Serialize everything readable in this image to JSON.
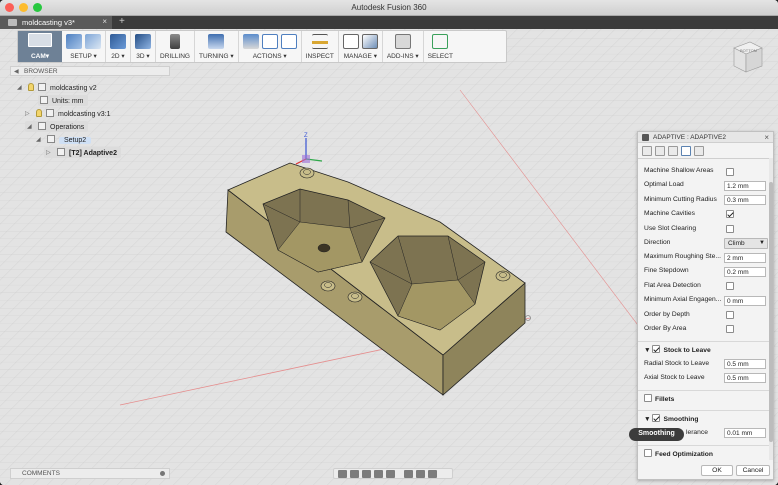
{
  "window": {
    "title": "Autodesk Fusion 360",
    "traffic_lights": [
      "#fc5f57",
      "#fdbc2e",
      "#28c840"
    ]
  },
  "tabs": {
    "document": "moldcasting v3*",
    "close": "×",
    "new_tab": "+"
  },
  "toolbar": {
    "workspace": "CAM▾",
    "groups": [
      {
        "label": "SETUP ▾",
        "icons": [
          "setup-icon",
          "setup-stock-icon"
        ]
      },
      {
        "label": "2D ▾",
        "icons": [
          "2d-pocket-icon"
        ]
      },
      {
        "label": "3D ▾",
        "icons": [
          "3d-adaptive-icon"
        ]
      },
      {
        "label": "DRILLING",
        "icons": [
          "drill-icon"
        ]
      },
      {
        "label": "TURNING ▾",
        "icons": [
          "turning-icon"
        ]
      },
      {
        "label": "ACTIONS ▾",
        "icons": [
          "simulate-icon",
          "post-process-icon",
          "setup-sheet-icon"
        ]
      },
      {
        "label": "INSPECT",
        "icons": [
          "measure-icon"
        ]
      },
      {
        "label": "MANAGE ▾",
        "icons": [
          "tool-library-icon",
          "template-icon"
        ]
      },
      {
        "label": "ADD-INS ▾",
        "icons": [
          "scripts-icon"
        ]
      },
      {
        "label": "SELECT",
        "icons": [
          "select-arrow-icon"
        ]
      }
    ]
  },
  "browser": {
    "header": "BROWSER",
    "items": [
      {
        "label": "moldcasting v2"
      },
      {
        "label": "Units: mm"
      },
      {
        "label": "moldcasting v3:1"
      },
      {
        "label": "Operations"
      },
      {
        "label": "Setup2"
      },
      {
        "label": "[T2] Adaptive2"
      }
    ]
  },
  "viewcube": {
    "face": "BOTTOM"
  },
  "panel": {
    "title": "ADAPTIVE : ADAPTIVE2",
    "close": "×",
    "rows": [
      {
        "label": "Machine Shallow Areas",
        "checked": false
      },
      {
        "label": "Optimal Load",
        "value": "1.2 mm"
      },
      {
        "label": "Minimum Cutting Radius",
        "value": "0.3 mm"
      },
      {
        "label": "Machine Cavities",
        "checked": true
      },
      {
        "label": "Use Slot Clearing",
        "checked": false
      },
      {
        "label": "Direction",
        "value": "Climb"
      },
      {
        "label": "Maximum Roughing Ste...",
        "value": "2 mm"
      },
      {
        "label": "Fine Stepdown",
        "value": "0.2 mm"
      },
      {
        "label": "Flat Area Detection",
        "checked": false
      },
      {
        "label": "Minimum Axial Engagen...",
        "value": "0 mm"
      },
      {
        "label": "Order by Depth",
        "checked": false
      },
      {
        "label": "Order By Area",
        "checked": false
      }
    ],
    "stock_section": "Stock to Leave",
    "stock_rows": [
      {
        "label": "Radial Stock to Leave",
        "value": "0.5 mm"
      },
      {
        "label": "Axial Stock to Leave",
        "value": "0.5 mm"
      }
    ],
    "fillets": "Fillets",
    "smoothing": "Smoothing",
    "smoothing_row": {
      "label": "Smoothing Tolerance",
      "label_visible": "lerance",
      "value": "0.01 mm"
    },
    "feed": "Feed Optimization",
    "ok": "OK",
    "cancel": "Cancel"
  },
  "tooltip": "Smoothing",
  "comments": {
    "label": "COMMENTS"
  },
  "axes": {
    "z": "Z"
  },
  "colors": {
    "part": "#c8bd8a",
    "workspace": "#6e8196",
    "panel_accent": "#5b82b1"
  }
}
